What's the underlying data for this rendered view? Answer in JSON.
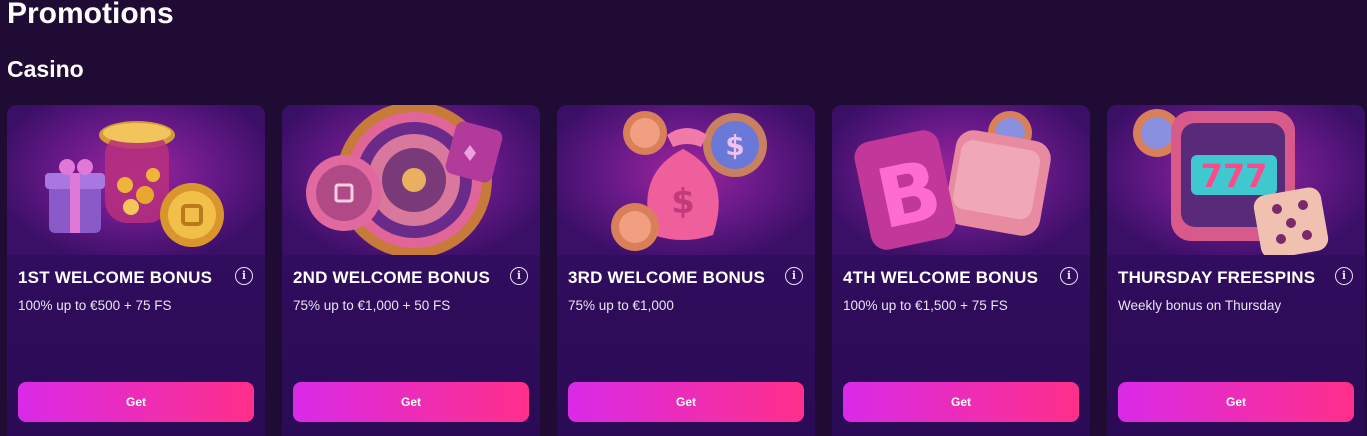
{
  "page": {
    "title": "Promotions"
  },
  "section": {
    "title": "Casino"
  },
  "cards": [
    {
      "title": "1ST WELCOME BONUS",
      "description": "100% up to €500 + 75 FS",
      "button": "Get",
      "info_icon": "ⓘ",
      "art": "gift-coin-jar-icon"
    },
    {
      "title": "2ND WELCOME BONUS",
      "description": "75% up to €1,000 + 50 FS",
      "button": "Get",
      "info_icon": "ⓘ",
      "art": "roulette-wheel-icon"
    },
    {
      "title": "3RD WELCOME BONUS",
      "description": "75% up to €1,000",
      "button": "Get",
      "info_icon": "ⓘ",
      "art": "money-bag-icon"
    },
    {
      "title": "4TH WELCOME BONUS",
      "description": "100% up to €1,500 + 75 FS",
      "button": "Get",
      "info_icon": "ⓘ",
      "art": "bitcoin-wallet-icon"
    },
    {
      "title": "THURSDAY FREESPINS",
      "description": "Weekly bonus on Thursday",
      "button": "Get",
      "info_icon": "ⓘ",
      "art": "slot-machine-dice-icon"
    }
  ],
  "colors": {
    "background": "#1f0b33",
    "card": "#2e0c5a",
    "button_start": "#d92ae8",
    "button_end": "#ff2f8a"
  }
}
